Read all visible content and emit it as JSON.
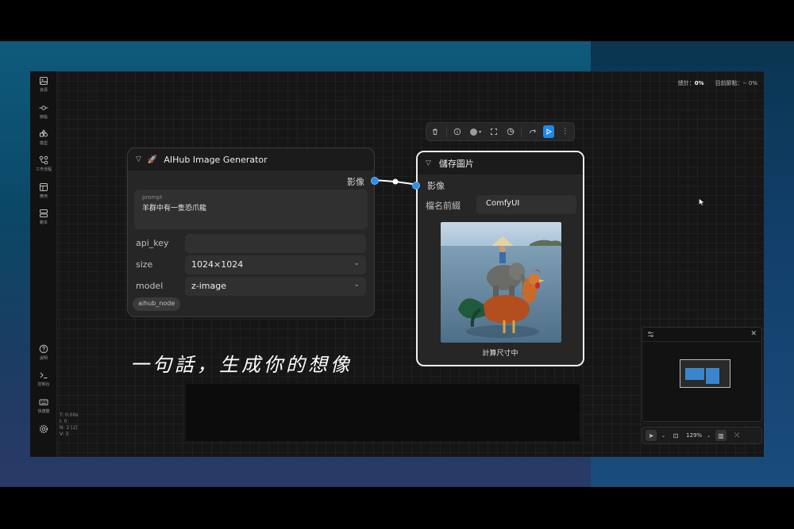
{
  "sidebar": {
    "items": [
      {
        "label": "資源",
        "icon": "image-icon"
      },
      {
        "label": "節點",
        "icon": "node-icon"
      },
      {
        "label": "模型",
        "icon": "model-icon"
      },
      {
        "label": "工作流程",
        "icon": "workflow-icon"
      },
      {
        "label": "應用",
        "icon": "app-icon"
      },
      {
        "label": "範本",
        "icon": "template-icon"
      }
    ],
    "bottom_items": [
      {
        "label": "說明",
        "icon": "help-icon"
      },
      {
        "label": "控制台",
        "icon": "terminal-icon"
      },
      {
        "label": "快捷鍵",
        "icon": "keyboard-icon"
      },
      {
        "label": "",
        "icon": "settings-icon"
      }
    ]
  },
  "stats": {
    "t": "T: 0.00s",
    "i": "I: 0",
    "n": "N: 2 [2]",
    "v": "V: 3"
  },
  "status": {
    "total_label": "總計：",
    "total_value": "0%",
    "current_label": "目前節點：",
    "current_value": "-- 0%"
  },
  "node_generator": {
    "title": "AIHub Image Generator",
    "title_icon": "rocket-icon",
    "output_label": "影像",
    "prompt_label": "prompt",
    "prompt_value": "羊群中有一隻恐爪龍",
    "api_key_label": "api_key",
    "api_key_value": "",
    "size_label": "size",
    "size_value": "1024×1024",
    "model_label": "model",
    "model_value": "z-image",
    "tag": "aihub_node"
  },
  "node_save": {
    "title": "儲存圖片",
    "input_label": "影像",
    "prefix_label": "檔名前綴",
    "prefix_value": "ComfyUI",
    "caption": "計算尺寸中"
  },
  "subtitle": "一句話，生成你的想像",
  "zoom": {
    "level": "129%"
  },
  "colors": {
    "accent": "#1d8ae8",
    "port": "#2f8fe0"
  }
}
